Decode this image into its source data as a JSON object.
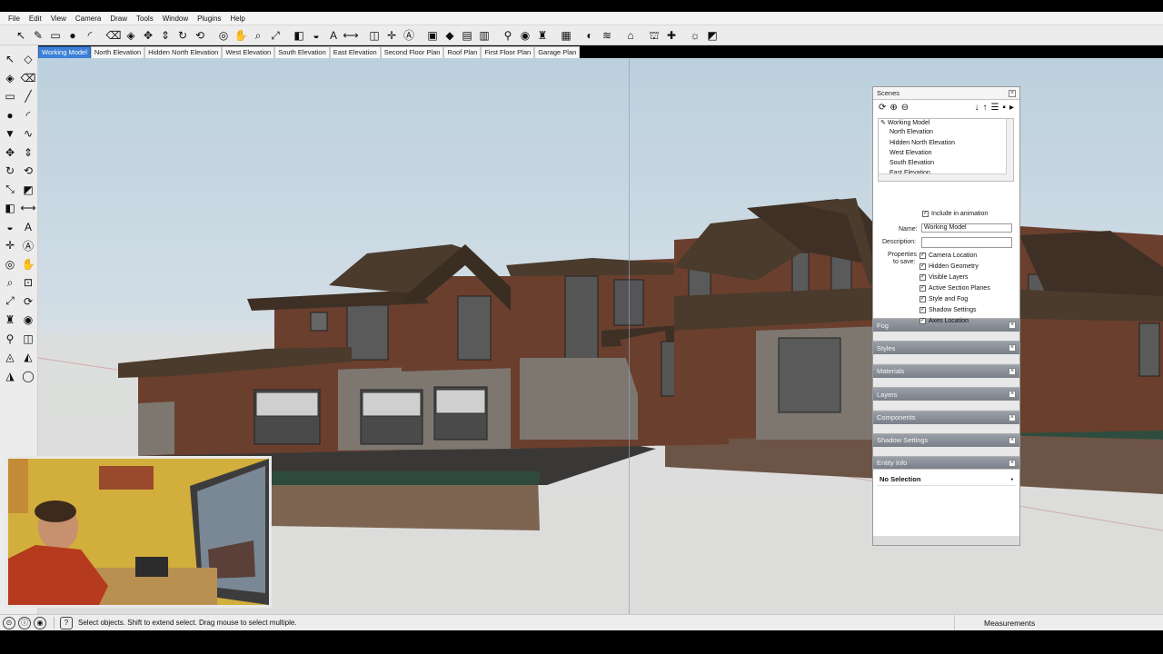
{
  "menu": [
    "File",
    "Edit",
    "View",
    "Camera",
    "Draw",
    "Tools",
    "Window",
    "Plugins",
    "Help"
  ],
  "toolbar_icons": [
    "select-arrow-icon",
    "pencil-icon",
    "rectangle-icon",
    "circle-icon",
    "arc-icon",
    "sep",
    "eraser-icon",
    "paint-bucket-icon",
    "move-icon",
    "push-pull-icon",
    "rotate-icon",
    "follow-me-icon",
    "sep",
    "orbit-icon",
    "pan-icon",
    "zoom-icon",
    "zoom-extents-icon",
    "sep",
    "tape-measure-icon",
    "protractor-icon",
    "text-icon",
    "dimension-icon",
    "sep",
    "section-plane-icon",
    "axes-icon",
    "3d-text-icon",
    "sep",
    "standard-view-icons",
    "iso-view-icon",
    "top-view-icon",
    "front-view-icon",
    "sep",
    "walk-icon",
    "look-around-icon",
    "position-camera-icon",
    "sep",
    "styles-icons",
    "sep",
    "shadow-icon",
    "fog-icon",
    "sep",
    "component-icons",
    "sep",
    "warehouse-icon",
    "extension-icon",
    "sep",
    "lightbulb-icon",
    "sandbox-icon"
  ],
  "scene_tabs": [
    "Working Model",
    "North Elevation",
    "Hidden North Elevation",
    "West Elevation",
    "South Elevation",
    "East Elevation",
    "Second Floor Plan",
    "Roof Plan",
    "First Floor Plan",
    "Garage Plan"
  ],
  "active_scene_tab": "Working Model",
  "scenes_panel": {
    "title": "Scenes",
    "list": [
      "Working Model",
      "North Elevation",
      "Hidden North Elevation",
      "West Elevation",
      "South Elevation",
      "East Elevation"
    ],
    "include_in_animation": "Include in animation",
    "name_label": "Name:",
    "name_value": "Working Model",
    "description_label": "Description:",
    "description_value": "",
    "properties_label_1": "Properties",
    "properties_label_2": "to save:",
    "properties": [
      "Camera Location",
      "Hidden Geometry",
      "Visible Layers",
      "Active Section Planes",
      "Style and Fog",
      "Shadow Settings",
      "Axes Location"
    ]
  },
  "collapsed_panels": [
    "Fog",
    "Styles",
    "Materials",
    "Layers",
    "Components",
    "Shadow Settings"
  ],
  "entity_info": {
    "title": "Entity Info",
    "selection": "No Selection"
  },
  "status": {
    "text": "Select objects. Shift to extend select. Drag mouse to select multiple.",
    "measurements_label": "Measurements"
  },
  "colors": {
    "active_tab": "#3d7fd6",
    "sky": "#c6d6e1",
    "ground": "#dcdcda",
    "roof": "#4a3b2c",
    "siding": "#6a3f2e",
    "stone": "#7d7770"
  }
}
